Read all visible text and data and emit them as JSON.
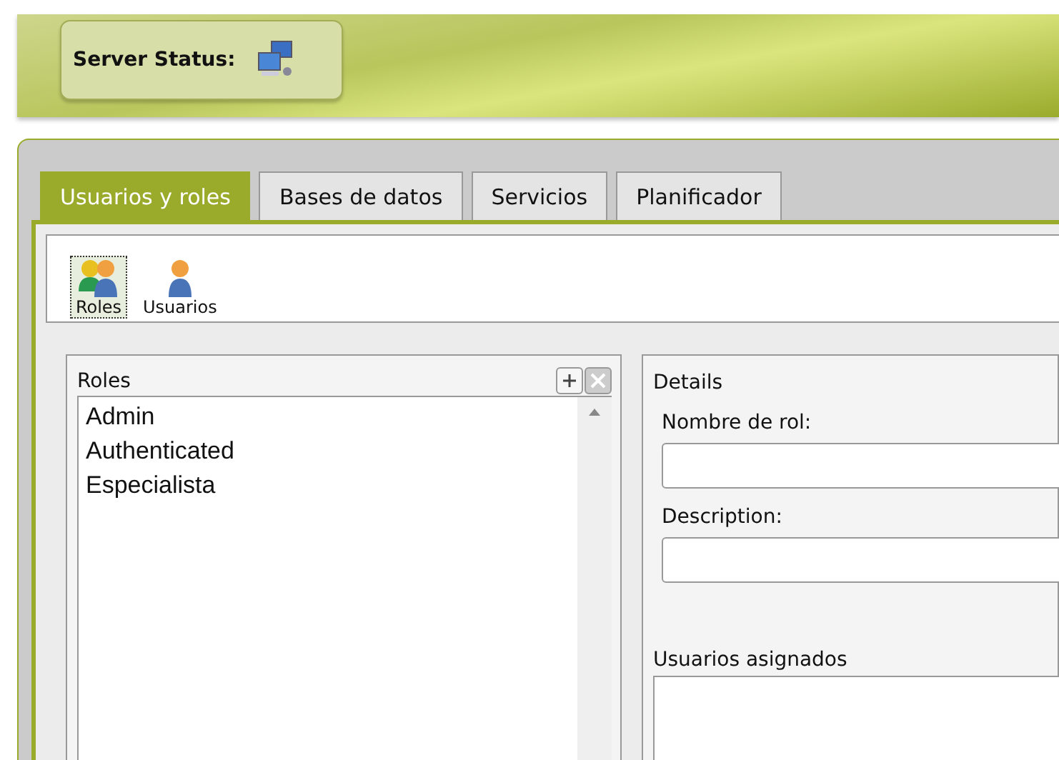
{
  "header": {
    "server_status": {
      "label": "Server Status:"
    }
  },
  "tabs": [
    {
      "label": "Usuarios y roles",
      "selected": true
    },
    {
      "label": "Bases de datos",
      "selected": false
    },
    {
      "label": "Servicios",
      "selected": false
    },
    {
      "label": "Planificador",
      "selected": false
    }
  ],
  "toolbar": [
    {
      "label": "Roles",
      "kind": "roles",
      "selected": true
    },
    {
      "label": "Usuarios",
      "kind": "user",
      "selected": false
    }
  ],
  "roles_panel": {
    "title": "Roles",
    "items": [
      "Admin",
      "Authenticated",
      "Especialista"
    ]
  },
  "details_panel": {
    "title": "Details",
    "fields": [
      {
        "label": "Nombre de rol:"
      },
      {
        "label": "Description:"
      }
    ],
    "assigned_title": "Usuarios asignados"
  }
}
